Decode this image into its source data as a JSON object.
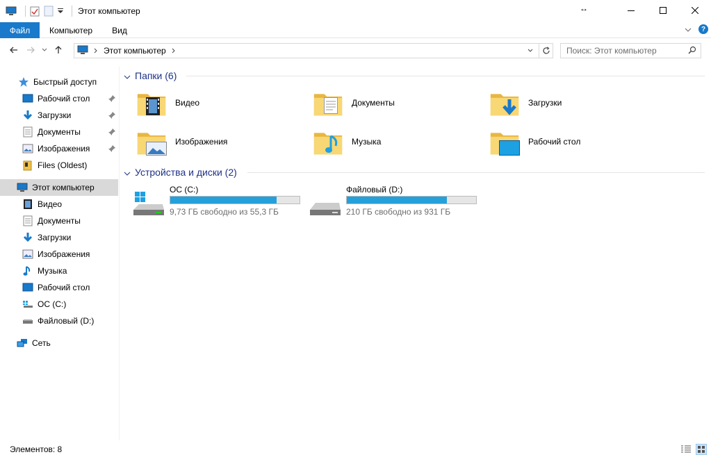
{
  "window": {
    "title": "Этот компьютер",
    "controls": [
      "minimize",
      "maximize",
      "close"
    ]
  },
  "ribbon": {
    "tabs": [
      {
        "label": "Файл",
        "active": true
      },
      {
        "label": "Компьютер"
      },
      {
        "label": "Вид"
      }
    ],
    "help_label": "?"
  },
  "navbar": {
    "breadcrumb": [
      "Этот компьютер"
    ],
    "search_placeholder": "Поиск: Этот компьютер"
  },
  "sidebar": {
    "quick_access": {
      "label": "Быстрый доступ",
      "items": [
        {
          "label": "Рабочий стол",
          "icon": "desktop-icon",
          "pinned": true
        },
        {
          "label": "Загрузки",
          "icon": "download-icon",
          "pinned": true
        },
        {
          "label": "Документы",
          "icon": "documents-icon",
          "pinned": true
        },
        {
          "label": "Изображения",
          "icon": "pictures-icon",
          "pinned": true
        },
        {
          "label": "Files (Oldest)",
          "icon": "folder-icon",
          "pinned": false
        }
      ]
    },
    "this_pc": {
      "label": "Этот компьютер",
      "items": [
        {
          "label": "Видео",
          "icon": "videos-icon"
        },
        {
          "label": "Документы",
          "icon": "documents-icon"
        },
        {
          "label": "Загрузки",
          "icon": "download-icon"
        },
        {
          "label": "Изображения",
          "icon": "pictures-icon"
        },
        {
          "label": "Музыка",
          "icon": "music-icon"
        },
        {
          "label": "Рабочий стол",
          "icon": "desktop-icon"
        },
        {
          "label": "ОС (C:)",
          "icon": "os-drive-icon"
        },
        {
          "label": "Файловый (D:)",
          "icon": "drive-icon"
        }
      ]
    },
    "network": {
      "label": "Сеть"
    }
  },
  "main": {
    "folders_group": {
      "label": "Папки (6)",
      "items": [
        {
          "label": "Видео",
          "icon": "videos-folder-icon"
        },
        {
          "label": "Документы",
          "icon": "documents-folder-icon"
        },
        {
          "label": "Загрузки",
          "icon": "downloads-folder-icon"
        },
        {
          "label": "Изображения",
          "icon": "pictures-folder-icon"
        },
        {
          "label": "Музыка",
          "icon": "music-folder-icon"
        },
        {
          "label": "Рабочий стол",
          "icon": "desktop-folder-icon"
        }
      ]
    },
    "drives_group": {
      "label": "Устройства и диски (2)",
      "items": [
        {
          "label": "ОС (C:)",
          "free_text": "9,73 ГБ свободно из 55,3 ГБ",
          "used_fraction": 0.824,
          "icon": "os-drive-icon"
        },
        {
          "label": "Файловый (D:)",
          "free_text": "210 ГБ свободно из 931 ГБ",
          "used_fraction": 0.774,
          "icon": "drive-icon"
        }
      ]
    }
  },
  "status": {
    "items_text": "Элементов: 8"
  },
  "colors": {
    "accent": "#1979ca",
    "group_header": "#1e3287",
    "selection": "#d9d9d9",
    "drive_fill": "#26a0da",
    "folder": "#f8d775"
  }
}
